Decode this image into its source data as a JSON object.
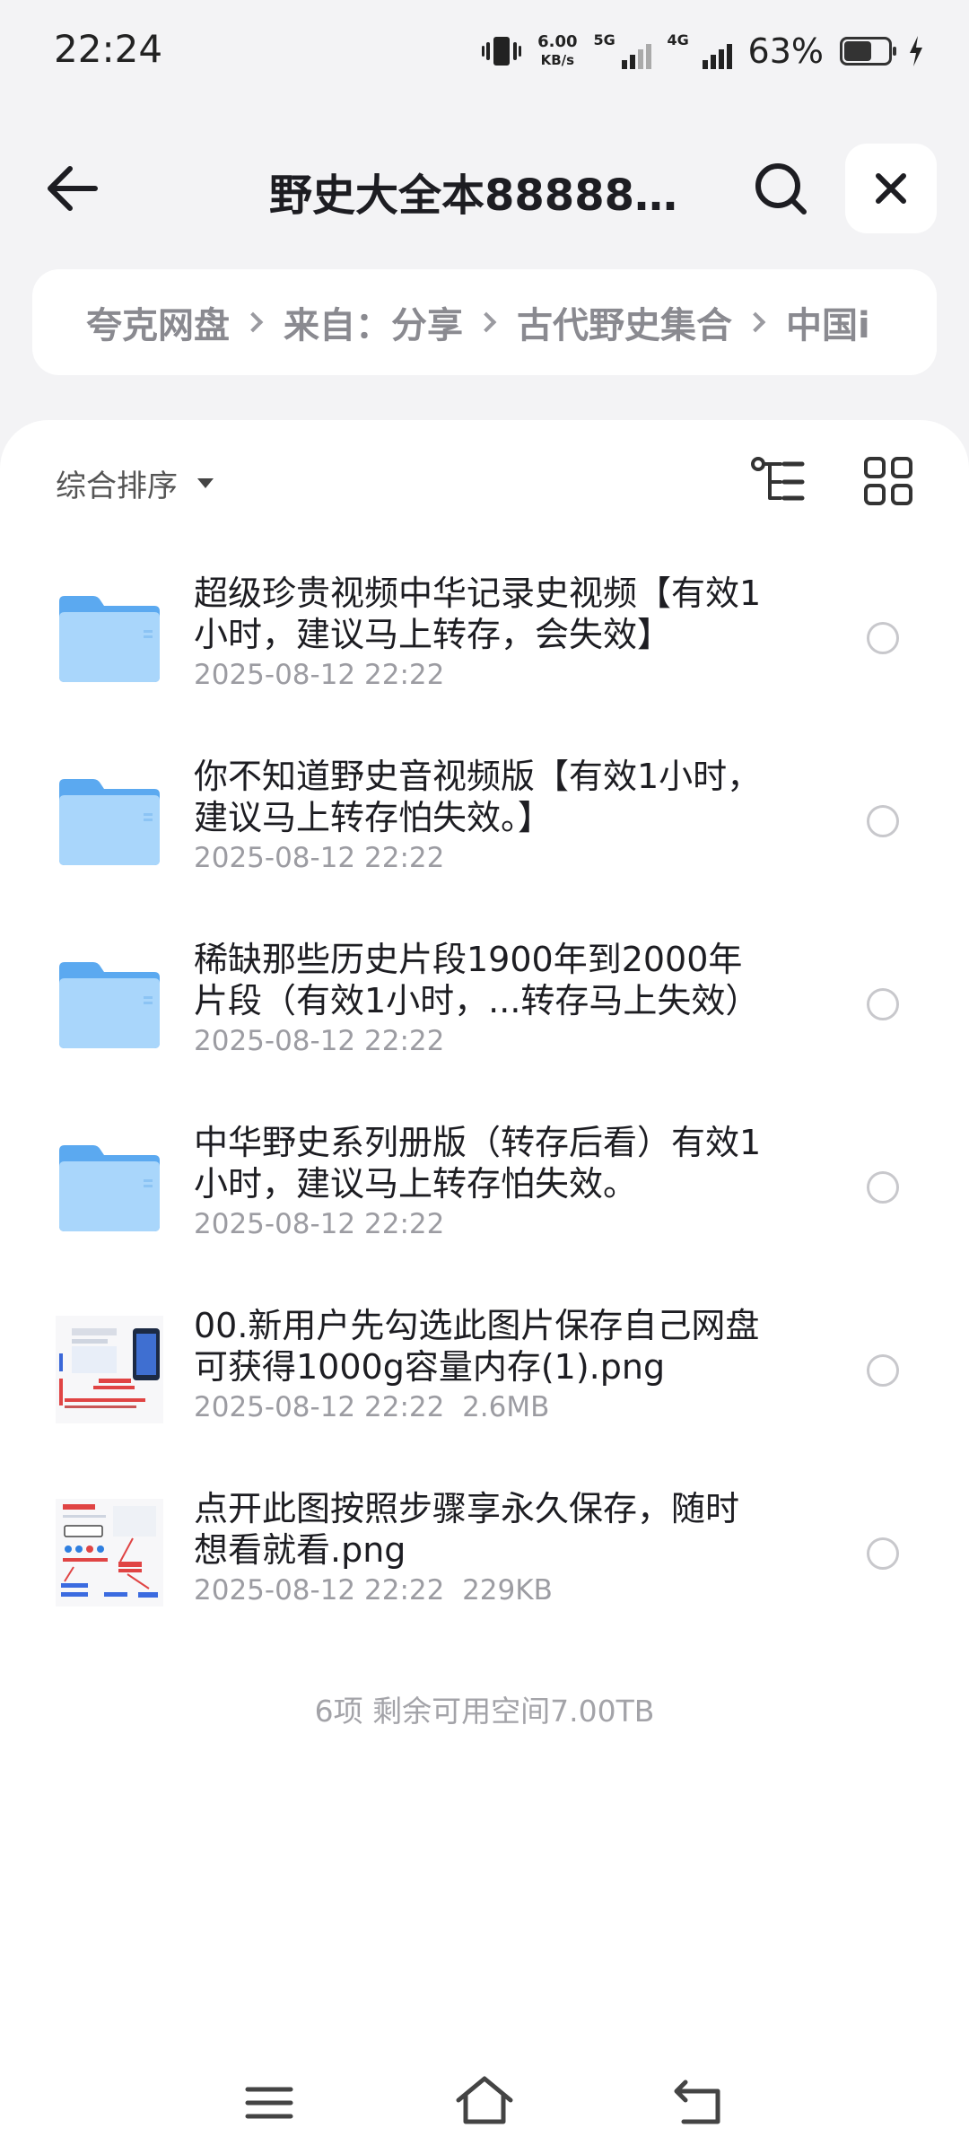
{
  "status": {
    "time": "22:24",
    "net_speed_value": "6.00",
    "net_speed_unit": "KB/s",
    "sim1_label": "5G",
    "sim2_label": "4G",
    "battery_percent": "63%",
    "battery_level": 0.63
  },
  "header": {
    "title": "野史大全本88888…"
  },
  "breadcrumb": [
    "夸克网盘",
    "来自：分享",
    "古代野史集合",
    "中国i"
  ],
  "toolbar": {
    "sort_label": "综合排序"
  },
  "files": [
    {
      "type": "folder",
      "name": "超级珍贵视频中华记录史视频【有效1小时，建议马上转存，会失效】",
      "date": "2025-08-12 22:22",
      "size": ""
    },
    {
      "type": "folder",
      "name": "你不知道野史音视频版【有效1小时，建议马上转存怕失效。】",
      "date": "2025-08-12 22:22",
      "size": ""
    },
    {
      "type": "folder",
      "name": "稀缺那些历史片段1900年到2000年片段（有效1小时，...转存马上失效）",
      "date": "2025-08-12 22:22",
      "size": ""
    },
    {
      "type": "folder",
      "name": "中华野史系列册版（转存后看）有效1小时，建议马上转存怕失效。",
      "date": "2025-08-12 22:22",
      "size": ""
    },
    {
      "type": "image",
      "name": "00.新用户先勾选此图片保存自己网盘可获得1000g容量内存(1).png",
      "date": "2025-08-12 22:22",
      "size": "2.6MB"
    },
    {
      "type": "image",
      "name": "点开此图按照步骤享永久保存，随时想看就看.png",
      "date": "2025-08-12 22:22",
      "size": "229KB"
    }
  ],
  "footer": {
    "summary": "6项 剩余可用空间7.00TB"
  },
  "colors": {
    "folder": "#6fb8f5",
    "folder_light": "#a9d6fb",
    "background": "#f3f3f5"
  }
}
